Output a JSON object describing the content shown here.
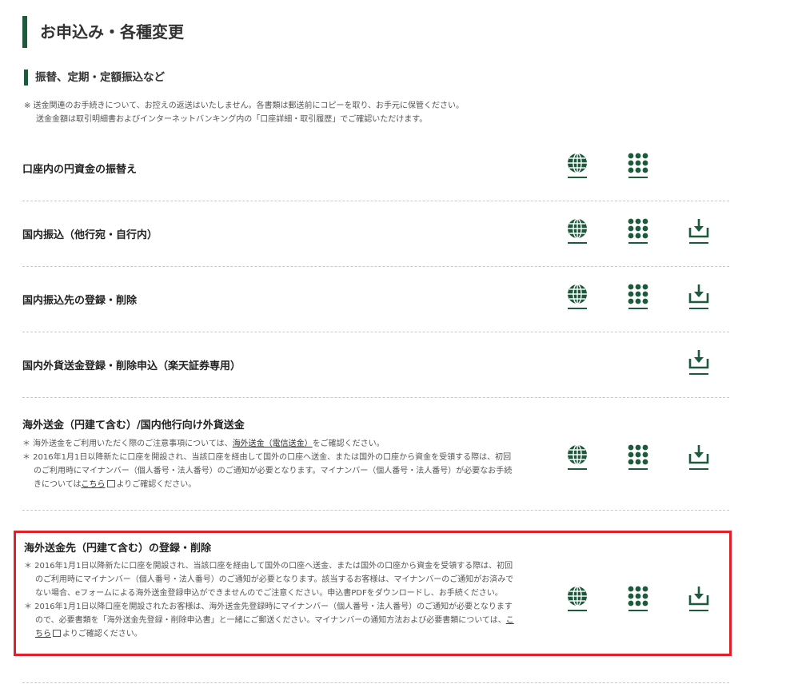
{
  "page": {
    "title": "お申込み・各種変更",
    "section_title": "振替、定期・定額振込など",
    "note_line1": "※ 送金関連のお手続きについて、お控えの返送はいたしません。各書類は郵送前にコピーを取り、お手元に保管ください。",
    "note_line2": "送金金額は取引明細書およびインターネットバンキング内の「口座詳細・取引履歴」でご確認いただけます。"
  },
  "rows": [
    {
      "title": "口座内の円資金の振替え"
    },
    {
      "title": "国内振込（他行宛・自行内）"
    },
    {
      "title": "国内振込先の登録・削除"
    },
    {
      "title": "国内外貨送金登録・削除申込（楽天証券専用）"
    },
    {
      "title": "海外送金（円建て含む）/国内他行向け外貨送金",
      "n1_pre": "＊ 海外送金をご利用いただく際のご注意事項については、",
      "n1_link": "海外送金（電信送金）",
      "n1_post": "をご確認ください。",
      "n2_pre": "＊ 2016年1月1日以降新たに口座を開設され、当該口座を経由して国外の口座へ送金、または国外の口座から資金を受領する際は、初回のご利用時にマイナンバー（個人番号・法人番号）のご通知が必要となります。マイナンバー（個人番号・法人番号）が必要なお手続きについては",
      "n2_link": "こちら",
      "n2_post": "よりご確認ください。"
    },
    {
      "title": "海外送金先（円建て含む）の登録・削除",
      "n1": "＊ 2016年1月1日以降新たに口座を開設され、当該口座を経由して国外の口座へ送金、または国外の口座から資金を受領する際は、初回のご利用時にマイナンバー（個人番号・法人番号）のご通知が必要となります。該当するお客様は、マイナンバーのご通知がお済みでない場合、eフォームによる海外送金登録申込ができませんのでご注意ください。申込書PDFをダウンロードし、お手続ください。",
      "n2_pre": "＊ 2016年1月1日以降口座を開設されたお客様は、海外送金先登録時にマイナンバー（個人番号・法人番号）のご通知が必要となりますので、必要書類を「海外送金先登録・削除申込書」と一緒にご郵送ください。マイナンバーの通知方法および必要書類については、",
      "n2_link": "こちら",
      "n2_post": "よりご確認ください。"
    }
  ],
  "icons": {
    "internet": "globe-icon",
    "phone": "keypad-icon",
    "download": "download-icon",
    "color": "#1d5a3c"
  },
  "highlight_color": "#e0212b"
}
